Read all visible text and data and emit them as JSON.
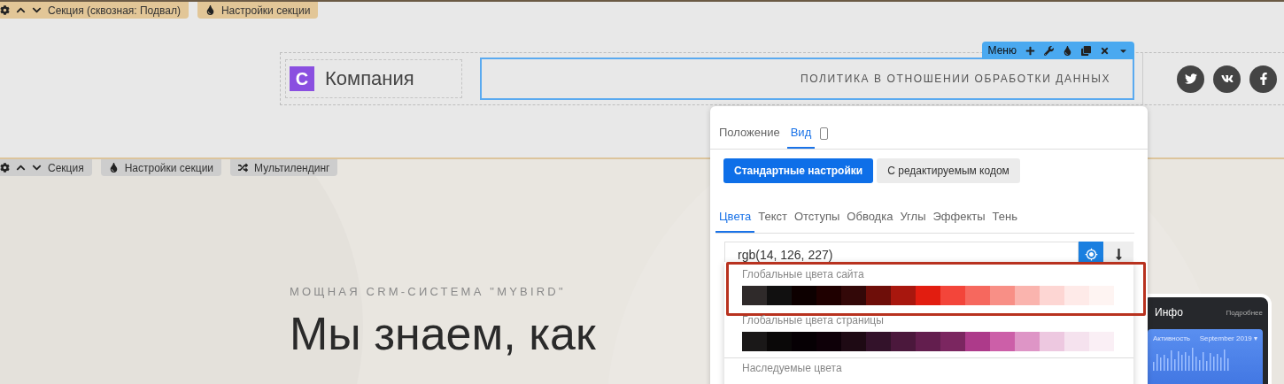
{
  "footer_section": {
    "toolbar": [
      {
        "kind": "section",
        "label": "Секция (сквозная: Подвал)"
      },
      {
        "kind": "settings",
        "label": "Настройки секции"
      }
    ],
    "logo": {
      "letter": "С",
      "name": "Компания"
    },
    "menu": {
      "toolbar_label": "Меню",
      "items": [
        "ПОЛИТИКА В ОТНОШЕНИИ ОБРАБОТКИ ДАННЫХ"
      ]
    }
  },
  "hero_section": {
    "toolbar": [
      {
        "kind": "section",
        "label": "Секция"
      },
      {
        "kind": "settings",
        "label": "Настройки секции"
      },
      {
        "kind": "multilanding",
        "label": "Мультилендинг"
      }
    ],
    "eyebrow": "МОЩНАЯ CRM-СИСТЕМА \"MYBIRD\"",
    "heading": "Мы знаем, как",
    "phone": {
      "title": "Инфо",
      "link": "Подробнее",
      "card_title": "Активность",
      "card_period": "September 2019 ▾"
    }
  },
  "settings_panel": {
    "tabs": [
      {
        "label": "Положение",
        "selected": false
      },
      {
        "label": "Вид",
        "selected": true
      }
    ],
    "modes": [
      {
        "label": "Стандартные настройки",
        "selected": true
      },
      {
        "label": "С редактируемым кодом",
        "selected": false
      }
    ],
    "subtabs": [
      {
        "label": "Цвета",
        "selected": true
      },
      {
        "label": "Текст",
        "selected": false
      },
      {
        "label": "Отступы",
        "selected": false
      },
      {
        "label": "Обводка",
        "selected": false
      },
      {
        "label": "Углы",
        "selected": false
      },
      {
        "label": "Эффекты",
        "selected": false
      },
      {
        "label": "Тень",
        "selected": false
      }
    ],
    "color_input": {
      "value": "rgb(14, 126, 227)"
    },
    "palette": {
      "groups": [
        {
          "title": "Глобальные цвета сайта",
          "highlighted": true,
          "swatches": [
            {
              "color": "#2f2a2a"
            },
            {
              "color": "#111010"
            },
            {
              "color": "#0d0000"
            },
            {
              "color": "#1f0000"
            },
            {
              "color": "#330808"
            },
            {
              "color": "#6e0e09"
            },
            {
              "color": "#a8170e"
            },
            {
              "color": "#e21d10"
            },
            {
              "color": "#f3453a"
            },
            {
              "color": "#f6685e"
            },
            {
              "color": "#f88f86"
            },
            {
              "color": "#fab4ae"
            },
            {
              "color": "#fdd6d3"
            },
            {
              "color": "#feeae8"
            },
            {
              "color": "#fef4f2"
            }
          ]
        },
        {
          "title": "Глобальные цвета страницы",
          "highlighted": false,
          "swatches": [
            {
              "color": "#1a1818"
            },
            {
              "color": "#0a0808"
            },
            {
              "color": "#060004"
            },
            {
              "color": "#0e0008"
            },
            {
              "color": "#1e0a14"
            },
            {
              "color": "#33122a"
            },
            {
              "color": "#4b183c"
            },
            {
              "color": "#631e4e"
            },
            {
              "color": "#7b2660"
            },
            {
              "color": "#ad3a8a"
            },
            {
              "color": "#cc5fa8"
            },
            {
              "color": "#de95c6"
            },
            {
              "color": "#edc8e0"
            },
            {
              "color": "#f5e2ee"
            },
            {
              "color": "#faeff5"
            }
          ]
        }
      ],
      "footer_title": "Наследуемые цвета"
    }
  }
}
